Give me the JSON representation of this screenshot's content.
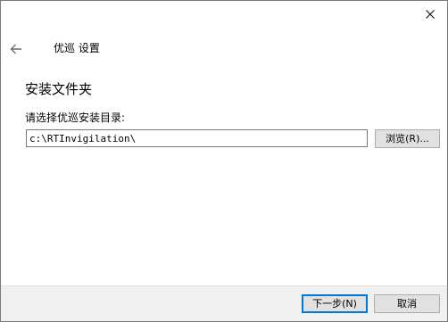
{
  "window": {
    "close_icon": "close-icon"
  },
  "header": {
    "back_icon": "back-arrow-icon",
    "title": "优巡 设置"
  },
  "main": {
    "section_title": "安装文件夹",
    "path_label": "请选择优巡安装目录:",
    "path_value": "c:\\RTInvigilation\\",
    "browse_label": "浏览(R)..."
  },
  "footer": {
    "next_label": "下一步(N)",
    "cancel_label": "取消"
  },
  "colors": {
    "footer_bg": "#f0f0f0",
    "default_button_border": "#0078d7",
    "button_bg": "#e1e1e1"
  }
}
